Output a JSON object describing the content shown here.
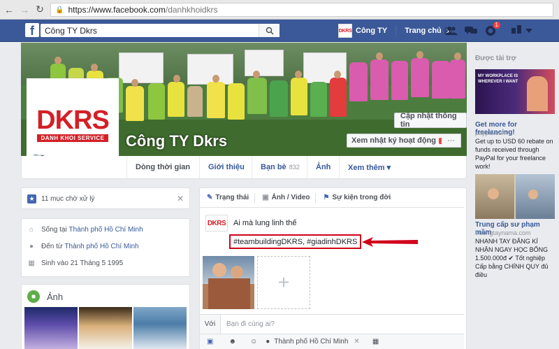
{
  "browser": {
    "url_host": "https://www.facebook.com",
    "url_path": "/danhkhoidkrs"
  },
  "header": {
    "search_value": "Công TY Dkrs",
    "profile_name": "Công TY",
    "profile_avatar_text": "DKRS",
    "home_label": "Trang chủ",
    "home_count": "1",
    "notification_count": "1",
    "icons": [
      "friends-icon",
      "messages-icon",
      "notifications-icon",
      "privacy-icon",
      "menu-icon"
    ]
  },
  "cover": {
    "page_name": "Công TY Dkrs",
    "update_info_label": "Cập nhật thông tin",
    "activity_log_label": "Xem nhật ký hoạt động",
    "activity_badge": "10+",
    "more_label": "···"
  },
  "profile_pic": {
    "logo_text": "DKRS",
    "logo_sub": "DANH KHOI SERVICE"
  },
  "tabs": [
    {
      "label": "Dòng thời gian"
    },
    {
      "label": "Giới thiệu"
    },
    {
      "label": "Bạn bè",
      "count": "832"
    },
    {
      "label": "Ảnh"
    },
    {
      "label": "Xem thêm ▾"
    }
  ],
  "left": {
    "pending_text": "11 mục chờ xử lý",
    "intro": {
      "lives_prefix": "Sống tại ",
      "lives_link": "Thành phố Hồ Chí Minh",
      "from_prefix": "Đến từ ",
      "from_link": "Thành phố Hồ Chí Minh",
      "born": "Sinh vào 21 Tháng 5 1995"
    },
    "photos_title": "Ảnh"
  },
  "composer": {
    "tab_status": "Trạng thái",
    "tab_photo": "Ảnh / Video",
    "tab_event": "Sự kiện trong đời",
    "avatar_text": "DKRS",
    "text": "Ai mà lung linh thế",
    "hashtags": "#teambuildingDKRS, #giadinhDKRS",
    "with_label": "Với",
    "with_placeholder": "Bạn đi cùng ai?",
    "location": "Thành phố Hồ Chí Minh"
  },
  "sponsored": {
    "title": "Được tài trợ",
    "ads": [
      {
        "banner_text": "MY WORKPLACE IS WHEREVER I WANT",
        "title": "Get more for freelancing!",
        "domain": "paypal.com",
        "body": "Get up to USD 60 rebate on funds received through PayPal for your freelance work!"
      },
      {
        "title": "Trung cấp sư phạm mầm",
        "domain": "truongtaynama.com",
        "body": "NHANH TAY ĐĂNG KÍ NHẬN NGAY HỌC BỔNG 1.500.000đ ✔ Tốt nghiệp Cấp bằng CHÍNH QUY đủ điều"
      }
    ]
  },
  "colors": {
    "fb_blue": "#3b5998",
    "link": "#365899",
    "brand_red": "#d32027",
    "highlight_red": "#d0021b"
  }
}
